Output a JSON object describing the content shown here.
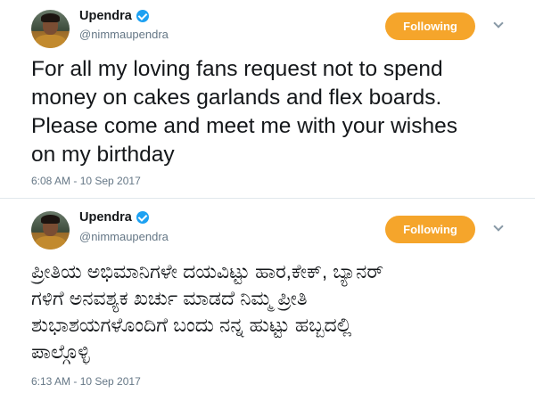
{
  "tweets": [
    {
      "author_name": "Upendra",
      "handle": "@nimmaupendra",
      "follow_label": "Following",
      "text": "For all my loving fans request not to spend\nmoney on cakes garlands and flex boards.\nPlease come and meet me with your wishes\non my birthday",
      "timestamp": "6:08 AM - 10 Sep 2017"
    },
    {
      "author_name": "Upendra",
      "handle": "@nimmaupendra",
      "follow_label": "Following",
      "text": "ಪ್ರೀತಿಯ ಅಭಿಮಾನಿಗಳೇ ದಯವಿಟ್ಟು ಹಾರ,ಕೇಕ್, ಬ್ಯಾನರ್\nಗಳಿಗೆ ಅನವಶ್ಯಕ ಖರ್ಚು ಮಾಡದೆ ನಿಮ್ಮ ಪ್ರೀತಿ\nಶುಭಾಶಯಗಳೊಂದಿಗೆ ಬಂದು ನನ್ನ ಹುಟ್ಟು ಹಬ್ಬದಲ್ಲಿ\nಪಾಲ್ಗೊಳ್ಳಿ",
      "timestamp": "6:13 AM - 10 Sep 2017"
    }
  ],
  "colors": {
    "follow_button": "#f5a52b",
    "verified": "#1da1f2",
    "secondary_text": "#657786"
  },
  "icons": {
    "verified": "verified-badge-icon",
    "menu": "chevron-down-icon"
  }
}
